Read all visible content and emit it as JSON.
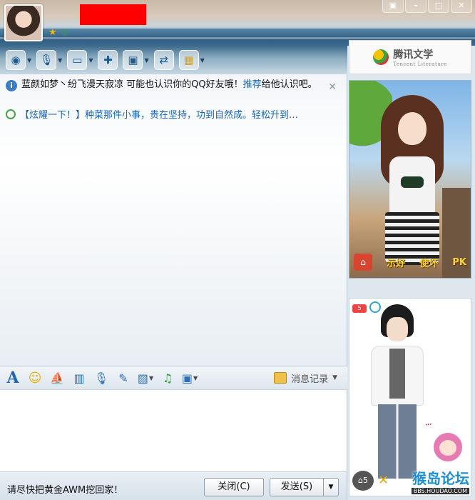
{
  "notice": {
    "text": "蓝颜如梦丶纷飞漫天寂凉 可能也认识你的QQ好友哦！",
    "link": "推荐",
    "suffix": "给他认识吧。"
  },
  "promo": {
    "text": "【炫耀一下！】种菜那件小事，贵在坚持，功到自然成。轻松升到…"
  },
  "tencent_literature": {
    "name": "腾讯文学",
    "subtitle": "Tencent Literature"
  },
  "show_panel": {
    "labels": [
      "示好",
      "使坏",
      "PK"
    ]
  },
  "bottom_badge": {
    "count": "5"
  },
  "input_toolbar": {
    "history_label": "消息记录"
  },
  "bottom_bar": {
    "tip": "请尽快把黄金AWM挖回家！",
    "close_label": "关闭(C)",
    "send_label": "发送(S)"
  },
  "watermark": {
    "title": "猴岛论坛",
    "url": "BBS.HOUDAO.COM"
  },
  "colors": {
    "redaction": "#ff0000",
    "link": "#1463b8"
  }
}
